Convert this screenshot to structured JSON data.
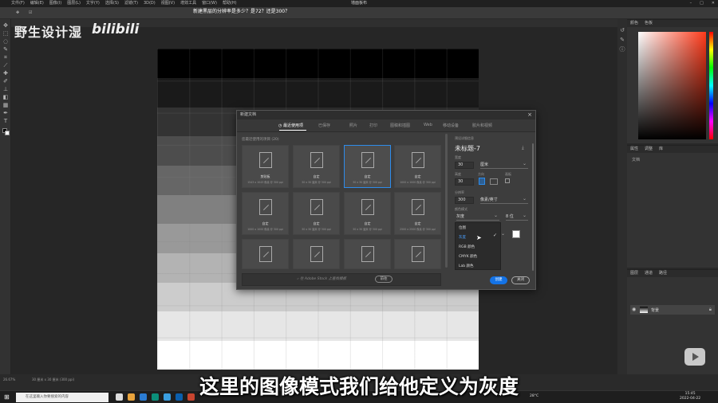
{
  "window": {
    "title": "墙面板布",
    "menus": [
      "文件(F)",
      "编辑(E)",
      "图像(I)",
      "图层(L)",
      "文字(Y)",
      "选择(S)",
      "滤镜(T)",
      "3D(D)",
      "视图(V)",
      "增效工具",
      "窗口(W)",
      "帮助(H)"
    ]
  },
  "video": {
    "question": "新建黑层的分辨率是多少？是72？还是300？",
    "watermark": "野生设计湿",
    "logo": "bilibili",
    "subtitle": "这里的图像模式我们给他定义为灰度"
  },
  "canvas_bands": [
    "#000000",
    "#1a1a1a",
    "#333333",
    "#4d4d4d",
    "#666666",
    "#808080",
    "#999999",
    "#b3b3b3",
    "#cccccc",
    "#e6e6e6",
    "#ffffff"
  ],
  "dialog": {
    "title": "新建文档",
    "close": "×",
    "tabs": [
      "最近使用项",
      "已保存",
      "照片",
      "打印",
      "图稿和插图",
      "Web",
      "移动设备",
      "胶片和视频"
    ],
    "recent_label": "您最近使用的项目 (20)",
    "presets": [
      {
        "name": "剪贴板",
        "size": "1543 x 1043 像素 @ 300 ppi"
      },
      {
        "name": "自定",
        "size": "30 x 30 厘米 @ 300 ppi"
      },
      {
        "name": "自定",
        "size": "30 x 30 厘米 @ 300 ppi"
      },
      {
        "name": "自定",
        "size": "1000 x 1000 像素 @ 300 ppi"
      },
      {
        "name": "自定",
        "size": "1000 x 1000 像素 @ 300 ppi"
      },
      {
        "name": "自定",
        "size": "30 x 30 厘米 @ 300 ppi"
      },
      {
        "name": "自定",
        "size": "30 x 30 厘米 @ 300 ppi"
      },
      {
        "name": "自定",
        "size": "2500 x 2500 像素 @ 300 ppi"
      }
    ],
    "search_placeholder": "在 Adobe Stock 上查找模板",
    "go": "前往",
    "details": {
      "header": "预设详细信息",
      "doc_name": "未标题-7",
      "width_label": "宽度",
      "width_value": "30",
      "width_unit": "厘米",
      "height_label": "高度",
      "height_value": "30",
      "orientation_label": "方向",
      "artboard_label": "画板",
      "resolution_label": "分辨率",
      "resolution_value": "300",
      "resolution_unit": "像素/英寸",
      "color_mode_label": "颜色模式",
      "color_mode_value": "灰度",
      "bit_depth": "8 位",
      "color_options": [
        "位图",
        "灰度",
        "RGB 颜色",
        "CMYK 颜色",
        "Lab 颜色"
      ],
      "create": "创建",
      "close": "关闭"
    }
  },
  "right_panels": {
    "color_tabs": [
      "颜色",
      "色板"
    ],
    "props_tabs": [
      "属性",
      "调整",
      "库"
    ],
    "props_item": "文档",
    "layers_tabs": [
      "图层",
      "通道",
      "路径"
    ],
    "layer_name": "背景"
  },
  "statusbar": {
    "zoom": "26.67%",
    "info": "30 厘米 x 30 厘米 (300 ppi)"
  },
  "taskbar": {
    "search_placeholder": "在这里输入你要搜索的内容",
    "weather": "28°C",
    "time": "15:45",
    "date": "2022-04-22"
  },
  "colors": {
    "accent": "#1473e6",
    "selected_border": "#2d8ceb"
  }
}
